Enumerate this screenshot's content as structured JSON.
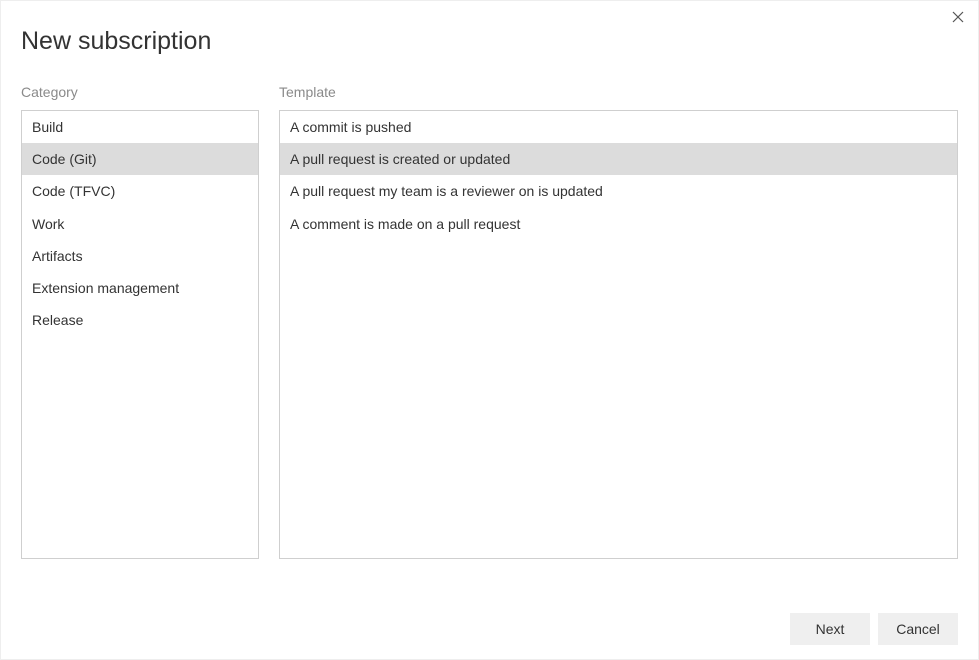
{
  "dialog": {
    "title": "New subscription"
  },
  "category": {
    "label": "Category",
    "items": [
      {
        "label": "Build",
        "selected": false
      },
      {
        "label": "Code (Git)",
        "selected": true
      },
      {
        "label": "Code (TFVC)",
        "selected": false
      },
      {
        "label": "Work",
        "selected": false
      },
      {
        "label": "Artifacts",
        "selected": false
      },
      {
        "label": "Extension management",
        "selected": false
      },
      {
        "label": "Release",
        "selected": false
      }
    ]
  },
  "template": {
    "label": "Template",
    "items": [
      {
        "label": "A commit is pushed",
        "selected": false
      },
      {
        "label": "A pull request is created or updated",
        "selected": true
      },
      {
        "label": "A pull request my team is a reviewer on is updated",
        "selected": false
      },
      {
        "label": "A comment is made on a pull request",
        "selected": false
      }
    ]
  },
  "buttons": {
    "next": "Next",
    "cancel": "Cancel"
  }
}
